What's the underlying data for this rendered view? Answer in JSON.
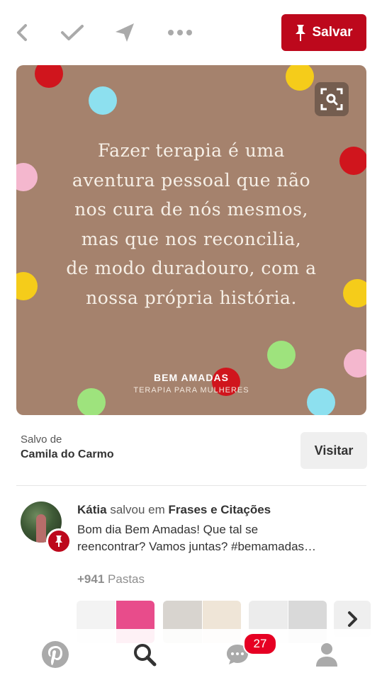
{
  "toolbar": {
    "save_label": "Salvar",
    "icons": [
      "back-arrow-icon",
      "check-icon",
      "send-icon",
      "more-icon"
    ]
  },
  "pin": {
    "quote_lines": [
      "Fazer terapia é uma",
      "aventura pessoal que não",
      "nos cura de nós mesmos,",
      "mas que nos reconcilia,",
      "de modo duradouro, com a",
      "nossa própria história."
    ],
    "brand_name": "BEM AMADAS",
    "brand_tagline": "TERAPIA PARA MULHERES",
    "background_color": "#a5826d"
  },
  "source": {
    "label": "Salvo de",
    "name": "Camila do Carmo",
    "visit_label": "Visitar"
  },
  "activity": {
    "user": "Kátia",
    "action": "salvou em",
    "board": "Frases e Citações",
    "description_line1": "Bom dia Bem Amadas! Que tal se",
    "description_line2": "reencontrar? Vamos juntas? #bemamadas…",
    "count": "+941",
    "count_label": "Pastas"
  },
  "tabbar": {
    "tabs": [
      "pinterest-logo-icon",
      "search-icon",
      "messages-icon",
      "profile-icon"
    ],
    "messages_badge": "27"
  },
  "colors": {
    "brand_red": "#bd081c",
    "badge_red": "#e60023"
  }
}
